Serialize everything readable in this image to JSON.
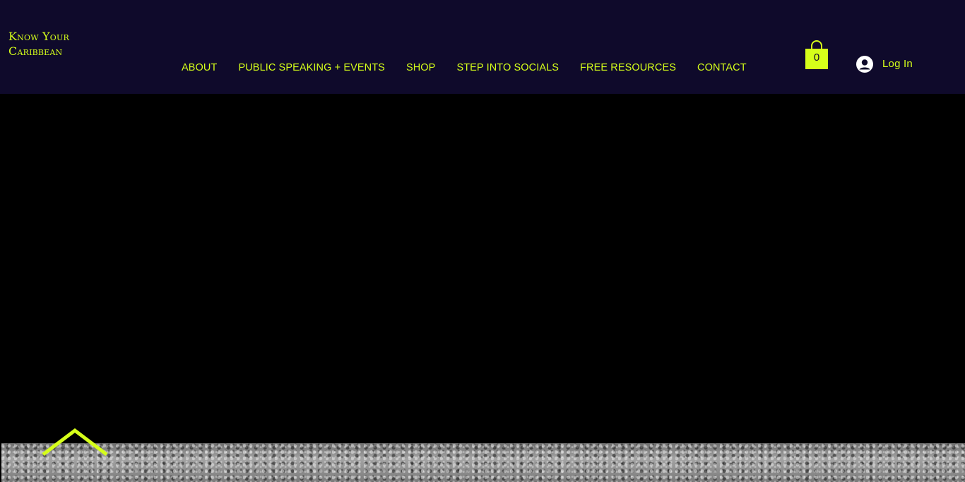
{
  "brand": {
    "line1": "Know Your",
    "line2": "Caribbean"
  },
  "nav": {
    "items": [
      {
        "label": "ABOUT"
      },
      {
        "label": "PUBLIC SPEAKING + EVENTS"
      },
      {
        "label": "SHOP"
      },
      {
        "label": "STEP INTO SOCIALS"
      },
      {
        "label": "FREE RESOURCES"
      },
      {
        "label": "CONTACT"
      }
    ]
  },
  "cart": {
    "count": "0",
    "icon": "shopping-bag-icon"
  },
  "login": {
    "label": "Log In",
    "icon": "user-avatar-icon"
  },
  "scroll": {
    "icon": "chevron-up-icon"
  },
  "colors": {
    "accent": "#d6ff1a",
    "header_bg": "#0f0a2b",
    "hero_bg": "#000000"
  }
}
